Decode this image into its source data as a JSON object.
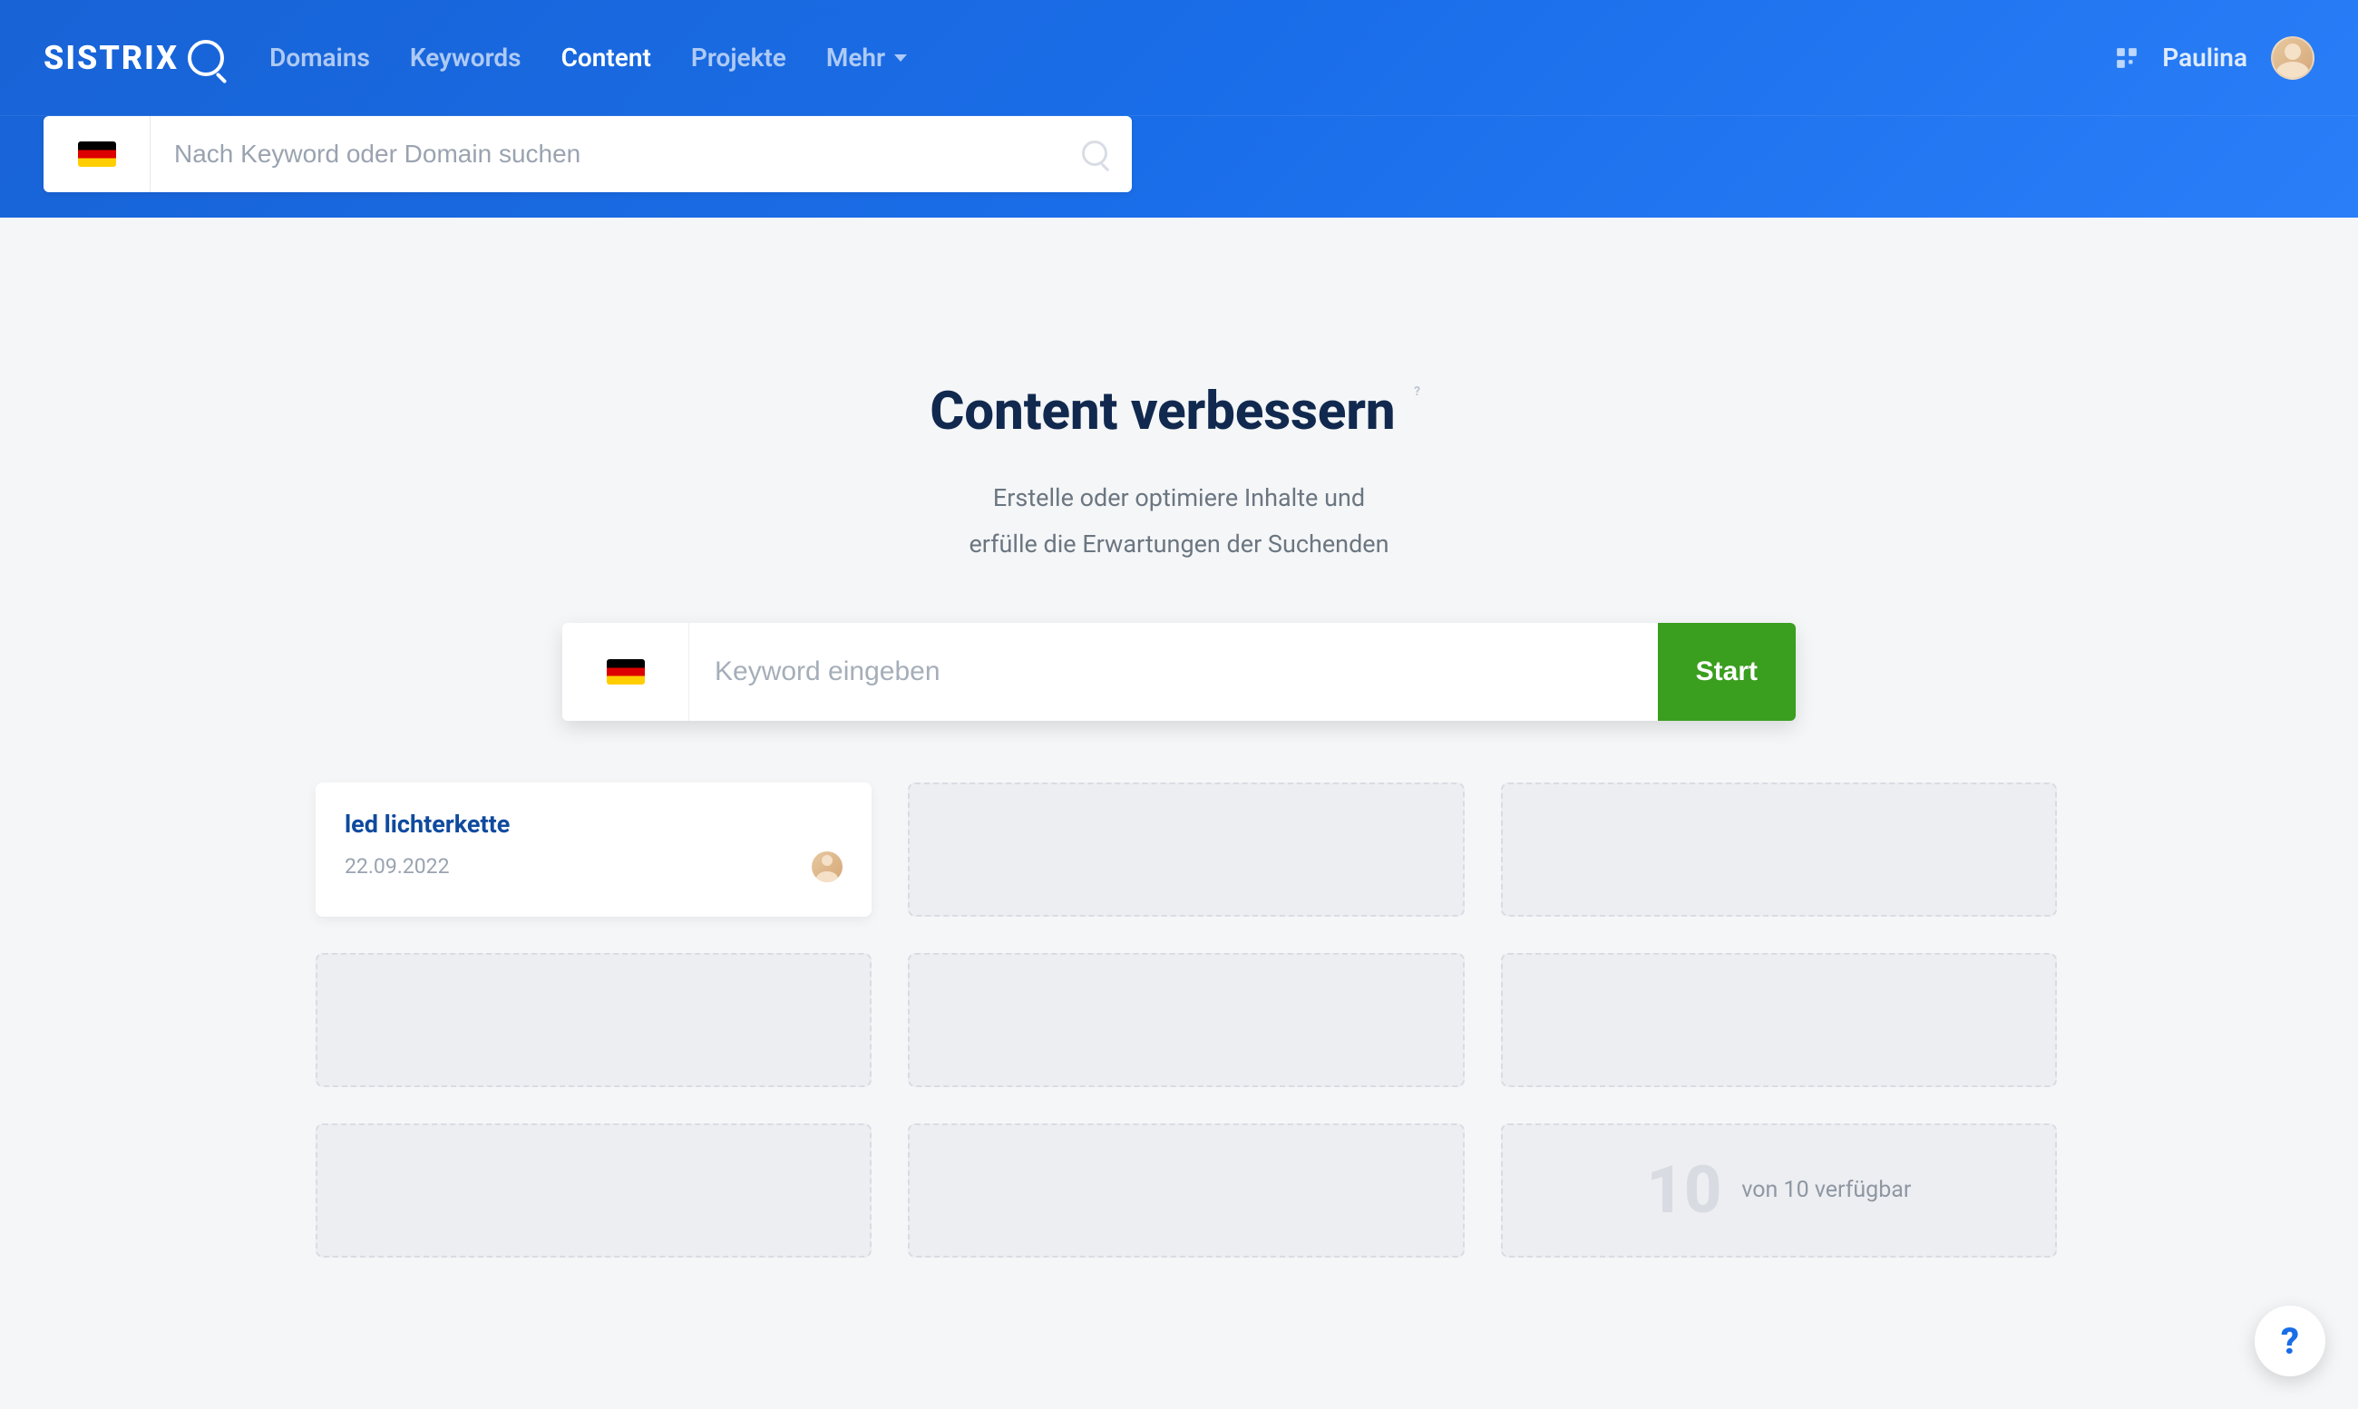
{
  "header": {
    "logo": "SISTRIX",
    "nav": [
      {
        "label": "Domains",
        "active": false
      },
      {
        "label": "Keywords",
        "active": false
      },
      {
        "label": "Content",
        "active": true
      },
      {
        "label": "Projekte",
        "active": false
      },
      {
        "label": "Mehr",
        "active": false,
        "dropdown": true
      }
    ],
    "user": "Paulina",
    "search_placeholder": "Nach Keyword oder Domain suchen"
  },
  "hero": {
    "title": "Content verbessern",
    "subtitle_line1": "Erstelle oder optimiere Inhalte und",
    "subtitle_line2": "erfülle die Erwartungen der Suchenden",
    "keyword_placeholder": "Keyword eingeben",
    "start_label": "Start"
  },
  "cards": {
    "entry": {
      "title": "led lichterkette",
      "date": "22.09.2022"
    },
    "remaining_count": "10",
    "available_text": "von 10 verfügbar"
  },
  "help": {
    "tooltip_icon": "?",
    "fab": "?"
  }
}
